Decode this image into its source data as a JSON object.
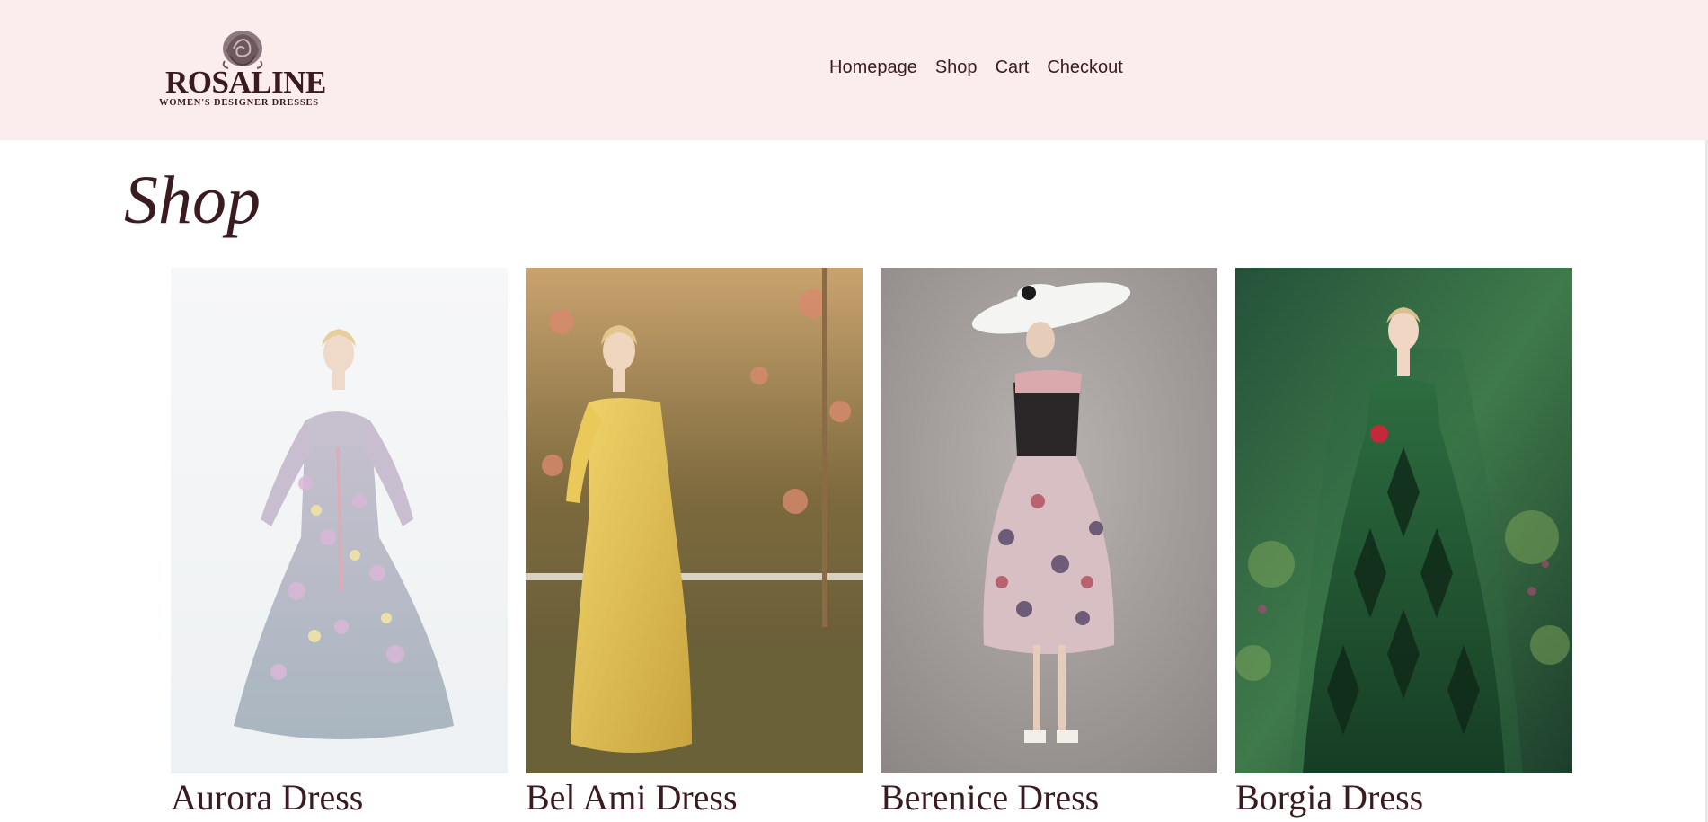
{
  "brand": {
    "name": "ROSALINE",
    "tagline": "WOMEN'S DESIGNER DRESSES",
    "logo_icon": "rose-icon"
  },
  "nav": {
    "items": [
      "Homepage",
      "Shop",
      "Cart",
      "Checkout"
    ]
  },
  "page": {
    "title": "Shop"
  },
  "products": [
    {
      "name": "Aurora Dress",
      "image": "woman in pastel floral tulle ball gown"
    },
    {
      "name": "Bel Ami Dress",
      "image": "woman in yellow silk gown in autumn garden"
    },
    {
      "name": "Berenice Dress",
      "image": "woman in floral corset midi dress with white hat"
    },
    {
      "name": "Borgia Dress",
      "image": "woman in green velvet gown in forest"
    }
  ],
  "colors": {
    "header_bg": "#fbeced",
    "text": "#3a1b20",
    "page_bg": "#ffffff"
  }
}
